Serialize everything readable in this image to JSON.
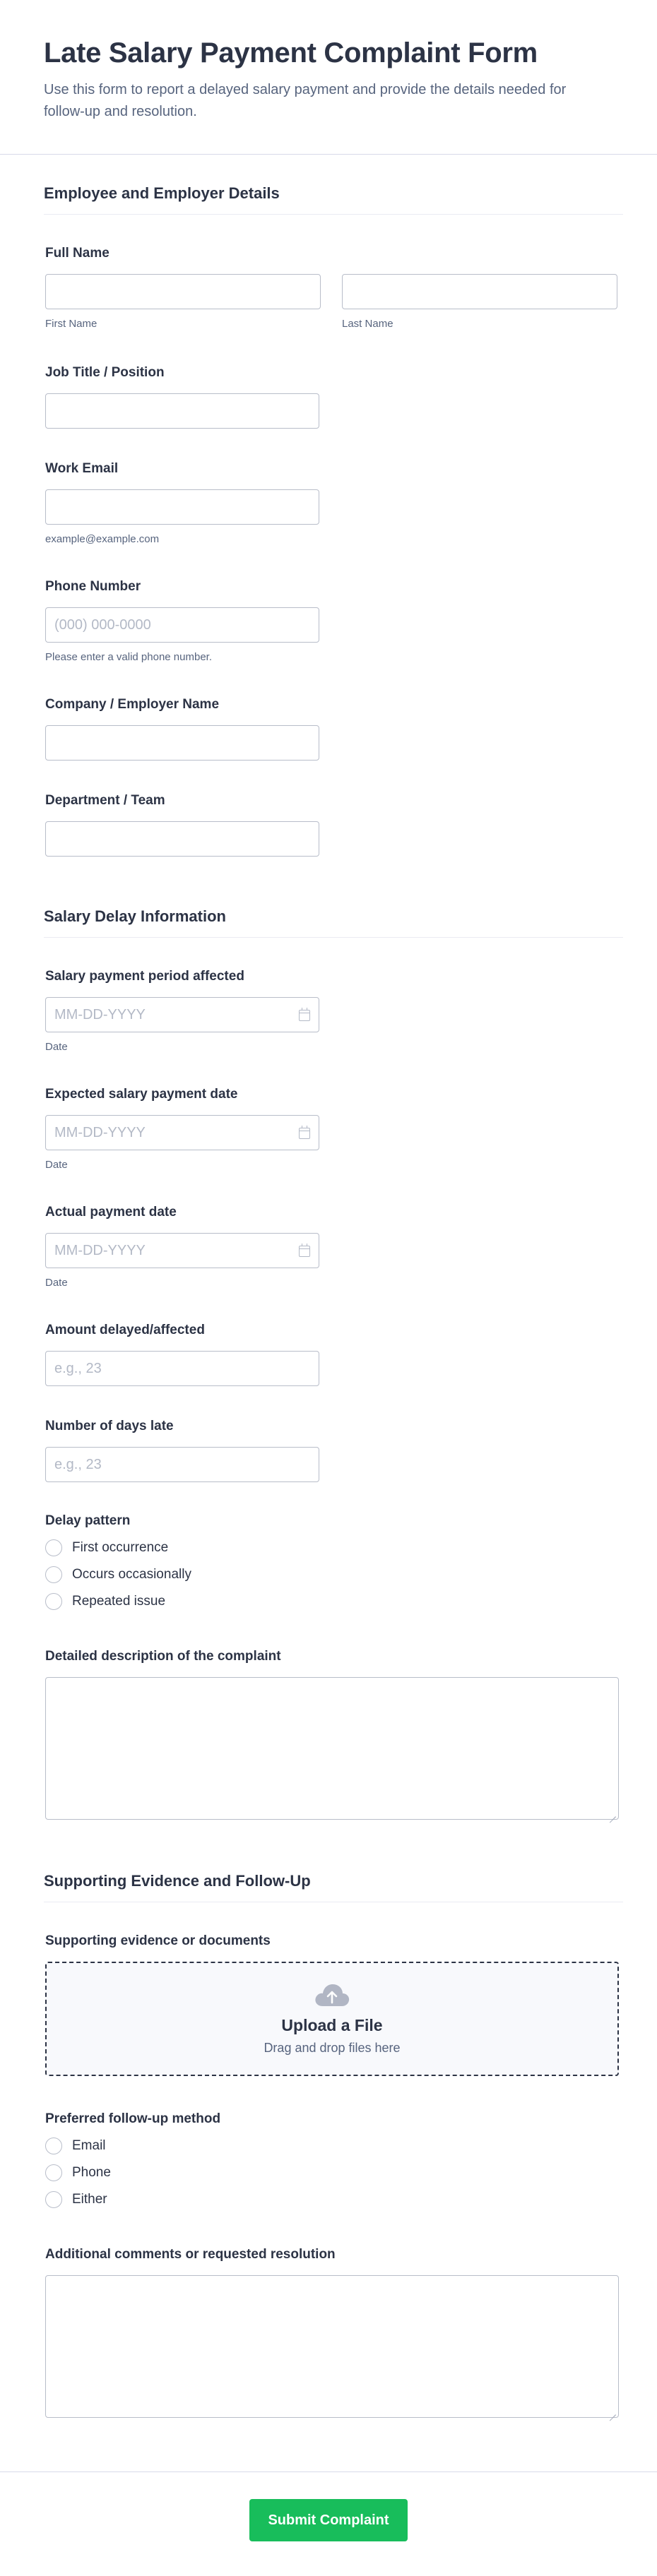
{
  "header": {
    "title": "Late Salary Payment Complaint Form",
    "subtitle": "Use this form to report a delayed salary payment and provide the details needed for follow-up and resolution."
  },
  "section1": {
    "title": "Employee and Employer Details",
    "full_name": {
      "label": "Full Name",
      "first_sub": "First Name",
      "last_sub": "Last Name",
      "first_value": "",
      "last_value": ""
    },
    "job_title": {
      "label": "Job Title / Position",
      "value": ""
    },
    "work_email": {
      "label": "Work Email",
      "value": "",
      "sub": "example@example.com"
    },
    "phone": {
      "label": "Phone Number",
      "placeholder": "(000) 000-0000",
      "sub": "Please enter a valid phone number."
    },
    "company": {
      "label": "Company / Employer Name",
      "value": ""
    },
    "department": {
      "label": "Department / Team",
      "value": ""
    }
  },
  "section2": {
    "title": "Salary Delay Information",
    "period": {
      "label": "Salary payment period affected",
      "placeholder": "MM-DD-YYYY",
      "sub": "Date"
    },
    "expected": {
      "label": "Expected salary payment date",
      "placeholder": "MM-DD-YYYY",
      "sub": "Date"
    },
    "actual": {
      "label": "Actual payment date",
      "placeholder": "MM-DD-YYYY",
      "sub": "Date"
    },
    "amount": {
      "label": "Amount delayed/affected",
      "placeholder": "e.g., 23"
    },
    "days_late": {
      "label": "Number of days late",
      "placeholder": "e.g., 23"
    },
    "pattern": {
      "label": "Delay pattern",
      "options": [
        "First occurrence",
        "Occurs occasionally",
        "Repeated issue"
      ]
    },
    "description": {
      "label": "Detailed description of the complaint",
      "value": ""
    }
  },
  "section3": {
    "title": "Supporting Evidence and Follow-Up",
    "evidence": {
      "label": "Supporting evidence or documents",
      "upload_title": "Upload a File",
      "upload_sub": "Drag and drop files here"
    },
    "followup": {
      "label": "Preferred follow-up method",
      "options": [
        "Email",
        "Phone",
        "Either"
      ]
    },
    "comments": {
      "label": "Additional comments or requested resolution",
      "value": ""
    }
  },
  "footer": {
    "submit_label": "Submit Complaint"
  },
  "colors": {
    "accent": "#18bd5b",
    "text": "#2c3345",
    "muted": "#57647e",
    "border": "#b8bdc9"
  },
  "icons": {
    "date": "calendar-icon",
    "upload": "cloud-upload-icon"
  }
}
